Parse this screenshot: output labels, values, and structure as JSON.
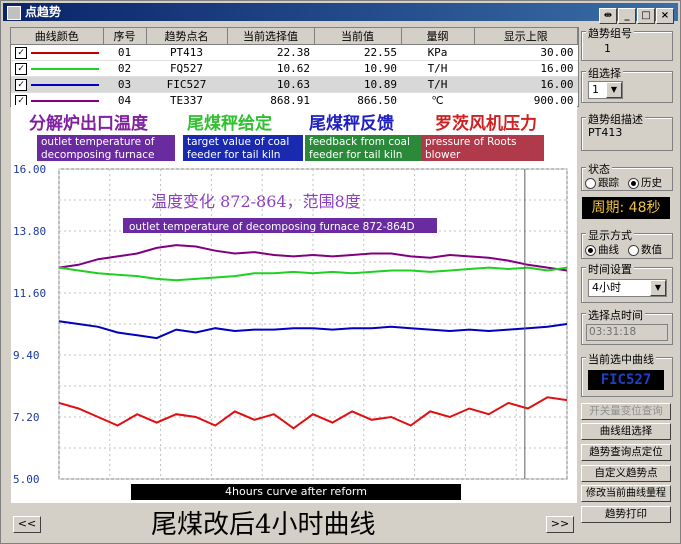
{
  "window": {
    "title": "点趋势",
    "buttons": [
      "⇹",
      "_",
      "□",
      "×"
    ]
  },
  "table": {
    "headers": [
      "曲线颜色",
      "序号",
      "趋势点名",
      "当前选择值",
      "当前值",
      "量纲",
      "显示上限"
    ],
    "rows": [
      {
        "color": "#c00000",
        "no": "01",
        "tag": "PT413",
        "sel": "22.38",
        "cur": "22.55",
        "unit": "KPa",
        "upper": "30.00"
      },
      {
        "color": "#20d020",
        "no": "02",
        "tag": "FQ527",
        "sel": "10.62",
        "cur": "10.90",
        "unit": "T/H",
        "upper": "16.00"
      },
      {
        "color": "#0000c0",
        "no": "03",
        "tag": "FIC527",
        "sel": "10.63",
        "cur": "10.89",
        "unit": "T/H",
        "upper": "16.00"
      },
      {
        "color": "#800080",
        "no": "04",
        "tag": "TE337",
        "sel": "868.91",
        "cur": "866.50",
        "unit": "℃",
        "upper": "900.00"
      }
    ]
  },
  "banner": {
    "cn": [
      "分解炉出口温度",
      "尾煤秤给定",
      "尾煤秤反馈",
      "罗茨风机压力"
    ],
    "en": [
      "outlet temperature of decomposing furnace",
      "target value of coal feeder for tail kiln",
      "feedback from coal feeder for tail kiln",
      "pressure of Roots blower"
    ],
    "cn_colors": [
      "#8020a0",
      "#30c030",
      "#2020c0",
      "#d02020"
    ],
    "en_colors": [
      "#6a2aa0",
      "#1a2ab0",
      "#2a8a3a",
      "#b03a4a"
    ]
  },
  "chart_data": {
    "type": "line",
    "yticks": [
      "16.00",
      "13.80",
      "11.60",
      "9.40",
      "7.20",
      "5.00"
    ],
    "ylim": [
      5.0,
      16.0
    ],
    "annotation_cn": "温度变化 872-864，范围8度",
    "annotation_en": "outlet temperature of decomposing furnace 872-864D",
    "series": [
      {
        "name": "TE337",
        "color": "#800080",
        "values": [
          12.5,
          12.6,
          12.8,
          12.9,
          13.0,
          13.2,
          13.3,
          13.25,
          13.1,
          13.0,
          13.05,
          12.95,
          12.9,
          12.95,
          12.9,
          12.95,
          13.0,
          13.0,
          12.9,
          12.85,
          12.95,
          12.9,
          12.85,
          12.75,
          12.6,
          12.5,
          12.4
        ]
      },
      {
        "name": "FQ527",
        "color": "#20d020",
        "values": [
          12.5,
          12.4,
          12.3,
          12.25,
          12.2,
          12.1,
          12.05,
          12.1,
          12.15,
          12.2,
          12.3,
          12.3,
          12.35,
          12.3,
          12.35,
          12.3,
          12.35,
          12.4,
          12.4,
          12.35,
          12.4,
          12.45,
          12.5,
          12.45,
          12.5,
          12.4,
          12.5
        ]
      },
      {
        "name": "FIC527",
        "color": "#0000c0",
        "values": [
          10.6,
          10.5,
          10.4,
          10.2,
          10.1,
          10.0,
          10.3,
          10.2,
          10.35,
          10.25,
          10.3,
          10.3,
          10.35,
          10.35,
          10.3,
          10.35,
          10.35,
          10.4,
          10.35,
          10.3,
          10.25,
          10.3,
          10.25,
          10.3,
          10.35,
          10.4,
          10.5
        ]
      },
      {
        "name": "PT413",
        "color": "#e01010",
        "values": [
          7.7,
          7.5,
          7.2,
          6.9,
          7.3,
          7.0,
          7.3,
          7.2,
          6.9,
          7.4,
          7.1,
          7.3,
          6.8,
          7.3,
          7.0,
          7.4,
          7.1,
          7.2,
          6.9,
          7.4,
          7.2,
          7.5,
          7.3,
          7.7,
          7.5,
          7.9,
          7.8
        ]
      }
    ]
  },
  "bottom_label": "4hours curve after reform",
  "caption_cn": "尾煤改后4小时曲线",
  "nav": {
    "prev": "<<",
    "next": ">>"
  },
  "right_panel": {
    "group_no_label": "趋势组号",
    "group_no_value": "1",
    "group_select_label": "组选择",
    "group_select_value": "1",
    "group_desc_label": "趋势组描述",
    "group_desc_value": "PT413",
    "state_label": "状态",
    "state_opt1": "跟踪",
    "state_opt2": "历史",
    "period": "周期: 48秒",
    "display_label": "显示方式",
    "display_opt1": "曲线",
    "display_opt2": "数值",
    "time_label": "时间设置",
    "time_value": "4小时",
    "point_time_label": "选择点时间",
    "point_time_value": "03:31:18",
    "current_curve_label": "当前选中曲线",
    "current_curve_value": "FIC527",
    "buttons": [
      "开关量变位查询",
      "曲线组选择",
      "趋势查询点定位",
      "自定义趋势点",
      "修改当前曲线量程",
      "趋势打印"
    ]
  }
}
